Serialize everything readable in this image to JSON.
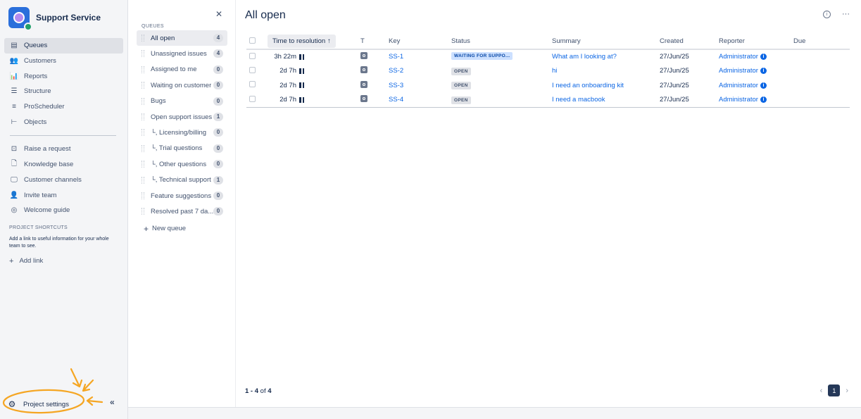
{
  "project": {
    "name": "Support Service",
    "accent": "#2a6fdb"
  },
  "nav": {
    "items": [
      {
        "label": "Queues",
        "icon": "queues-icon",
        "active": true
      },
      {
        "label": "Customers",
        "icon": "customers-icon"
      },
      {
        "label": "Reports",
        "icon": "reports-icon"
      },
      {
        "label": "Structure",
        "icon": "structure-icon"
      },
      {
        "label": "ProScheduler",
        "icon": "proscheduler-icon"
      },
      {
        "label": "Objects",
        "icon": "objects-icon"
      }
    ],
    "secondary": [
      {
        "label": "Raise a request",
        "icon": "raise-request-icon"
      },
      {
        "label": "Knowledge base",
        "icon": "knowledge-base-icon"
      },
      {
        "label": "Customer channels",
        "icon": "customer-channels-icon"
      },
      {
        "label": "Invite team",
        "icon": "invite-team-icon"
      },
      {
        "label": "Welcome guide",
        "icon": "welcome-guide-icon"
      }
    ],
    "shortcuts_title": "PROJECT SHORTCUTS",
    "shortcuts_desc": "Add a link to useful information for your whole team to see.",
    "add_link": "Add link",
    "settings_label": "Project settings",
    "collapse_glyph": "«"
  },
  "queues": {
    "title": "QUEUES",
    "items": [
      {
        "label": "All open",
        "count": "4",
        "active": true
      },
      {
        "label": "Unassigned issues",
        "count": "4"
      },
      {
        "label": "Assigned to me",
        "count": "0"
      },
      {
        "label": "Waiting on customer",
        "count": "0"
      },
      {
        "label": "Bugs",
        "count": "0"
      },
      {
        "label": "Open support issues",
        "count": "1"
      },
      {
        "label": "└, Licensing/billing",
        "count": "0"
      },
      {
        "label": "└, Trial questions",
        "count": "0"
      },
      {
        "label": "└, Other questions",
        "count": "0"
      },
      {
        "label": "└, Technical support",
        "count": "1"
      },
      {
        "label": "Feature suggestions",
        "count": "0"
      },
      {
        "label": "Resolved past 7 da...",
        "count": "0"
      }
    ],
    "new_queue": "New queue"
  },
  "main": {
    "title": "All open",
    "columns": {
      "time_to_resolution": "Time to resolution",
      "type": "T",
      "key": "Key",
      "status": "Status",
      "summary": "Summary",
      "created": "Created",
      "reporter": "Reporter",
      "due": "Due"
    },
    "rows": [
      {
        "ttr": "3h 22m",
        "key": "SS-1",
        "status": "WAITING FOR SUPPO...",
        "status_type": "waiting",
        "summary": "What am I looking at?",
        "created": "27/Jun/25",
        "reporter": "Administrator",
        "due": ""
      },
      {
        "ttr": "2d 7h",
        "key": "SS-2",
        "status": "OPEN",
        "status_type": "open",
        "summary": "hi",
        "created": "27/Jun/25",
        "reporter": "Administrator",
        "due": ""
      },
      {
        "ttr": "2d 7h",
        "key": "SS-3",
        "status": "OPEN",
        "status_type": "open",
        "summary": "I need an onboarding kit",
        "created": "27/Jun/25",
        "reporter": "Administrator",
        "due": ""
      },
      {
        "ttr": "2d 7h",
        "key": "SS-4",
        "status": "OPEN",
        "status_type": "open",
        "summary": "I need a macbook",
        "created": "27/Jun/25",
        "reporter": "Administrator",
        "due": ""
      }
    ],
    "pagination": {
      "range": "1 - 4",
      "of": "of",
      "total": "4",
      "current_page": "1"
    }
  },
  "colors": {
    "link": "#0c66e4",
    "annotation": "#f5a623",
    "waiting_lozenge": "#cce0ff"
  }
}
